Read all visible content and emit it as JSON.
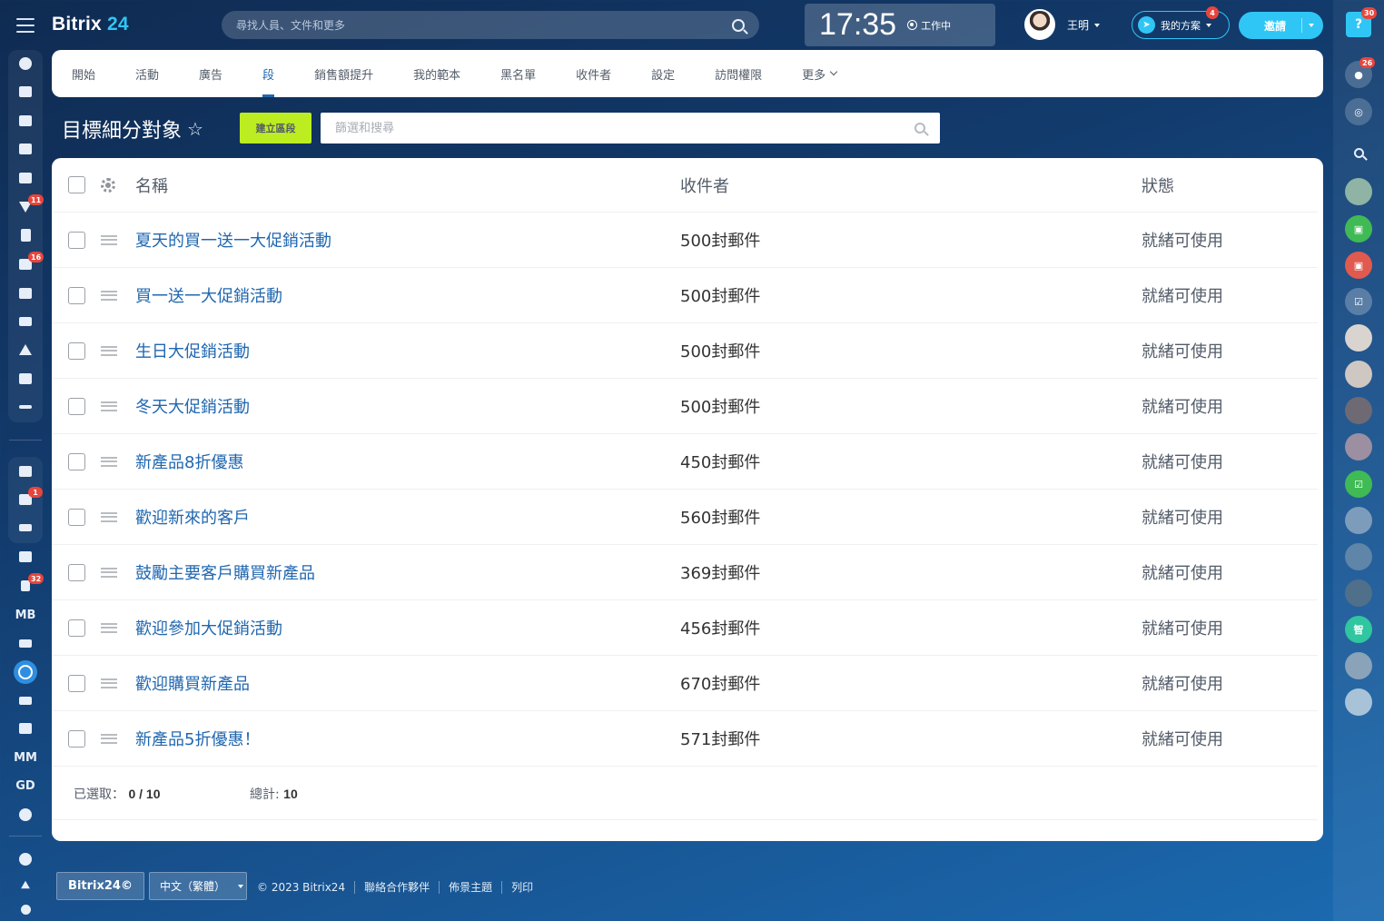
{
  "header": {
    "logo_main": "Bitrix",
    "logo_num": "24",
    "search_placeholder": "尋找人員、文件和更多",
    "clock": "17:35",
    "work_status": "工作中",
    "user_name": "王明",
    "plan_label": "我的方案",
    "plan_badge": "4",
    "invite_label": "邀請"
  },
  "left_sidebar": {
    "badges": {
      "filter": "11",
      "tasks": "16",
      "bot": "1",
      "monitor": "32"
    },
    "text_items": {
      "mb": "MB",
      "mm": "MM",
      "gd": "GD"
    }
  },
  "right_sidebar": {
    "help_badge": "30",
    "bell_badge": "26",
    "chat_label": "智"
  },
  "tabs": [
    {
      "label": "開始"
    },
    {
      "label": "活動"
    },
    {
      "label": "廣告"
    },
    {
      "label": "段"
    },
    {
      "label": "銷售額提升"
    },
    {
      "label": "我的範本"
    },
    {
      "label": "黑名單"
    },
    {
      "label": "收件者"
    },
    {
      "label": "設定"
    },
    {
      "label": "訪問權限"
    },
    {
      "label": "更多"
    }
  ],
  "page": {
    "title": "目標細分對象",
    "create_button": "建立區段",
    "filter_placeholder": "篩選和搜尋"
  },
  "table": {
    "columns": {
      "name": "名稱",
      "recipients": "收件者",
      "status": "狀態"
    },
    "rows": [
      {
        "name": "夏天的買一送一大促銷活動",
        "recipients": "500封郵件",
        "status": "就緒可使用"
      },
      {
        "name": "買一送一大促銷活動",
        "recipients": "500封郵件",
        "status": "就緒可使用"
      },
      {
        "name": "生日大促銷活動",
        "recipients": "500封郵件",
        "status": "就緒可使用"
      },
      {
        "name": "冬天大促銷活動",
        "recipients": "500封郵件",
        "status": "就緒可使用"
      },
      {
        "name": "新產品8折優惠",
        "recipients": "450封郵件",
        "status": "就緒可使用"
      },
      {
        "name": "歡迎新來的客戶",
        "recipients": "560封郵件",
        "status": "就緒可使用"
      },
      {
        "name": "鼓勵主要客戶購買新產品",
        "recipients": "369封郵件",
        "status": "就緒可使用"
      },
      {
        "name": "歡迎參加大促銷活動",
        "recipients": "456封郵件",
        "status": "就緒可使用"
      },
      {
        "name": "歡迎購買新產品",
        "recipients": "670封郵件",
        "status": "就緒可使用"
      },
      {
        "name": "新產品5折優惠！",
        "recipients": "571封郵件",
        "status": "就緒可使用"
      }
    ],
    "footer": {
      "selected_label": "已選取：",
      "selected_value": "0 / 10",
      "total_label": "總計:",
      "total_value": "10"
    }
  },
  "footer": {
    "brand_button": "Bitrix24©",
    "language": "中文（繁體）",
    "links": [
      "© 2023 Bitrix24",
      "聯絡合作夥伴",
      "佈景主題",
      "列印"
    ]
  },
  "colors": {
    "accent": "#2fc6f6",
    "link": "#2067b0",
    "create_button": "#bbed21",
    "badge": "#e8453c"
  }
}
